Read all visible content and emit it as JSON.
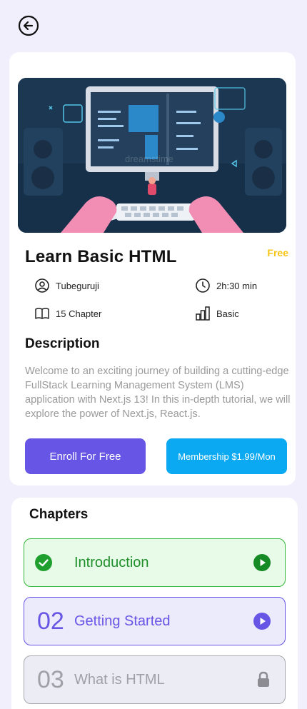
{
  "header": {
    "back_icon": "arrow-left-circle-icon"
  },
  "course": {
    "title": "Learn  Basic HTML",
    "price": "Free",
    "author": "Tubeguruji",
    "duration": "2h:30 min",
    "chapters_count": "15 Chapter",
    "level": "Basic",
    "description_title": "Description",
    "description": "Welcome to an exciting journey of building a cutting-edge FullStack Learning Management System (LMS) application with Next.js 13! In this in-depth tutorial, we will explore the power of Next.js, React.js.",
    "enroll_label": "Enroll For Free",
    "membership_label": "Membership $1.99/Mon",
    "watermark": "dreamstime"
  },
  "chapters_section": {
    "title": "Chapters",
    "items": [
      {
        "number": "",
        "name": "Introduction",
        "state": "completed",
        "icon": "play-icon"
      },
      {
        "number": "02",
        "name": "Getting Started",
        "state": "available",
        "icon": "play-icon"
      },
      {
        "number": "03",
        "name": "What is HTML",
        "state": "locked",
        "icon": "lock-icon"
      }
    ]
  },
  "colors": {
    "primary": "#6756e6",
    "membership": "#0aa9f2",
    "success": "#36b83a",
    "price": "#f5c518",
    "background": "#f1effb"
  }
}
